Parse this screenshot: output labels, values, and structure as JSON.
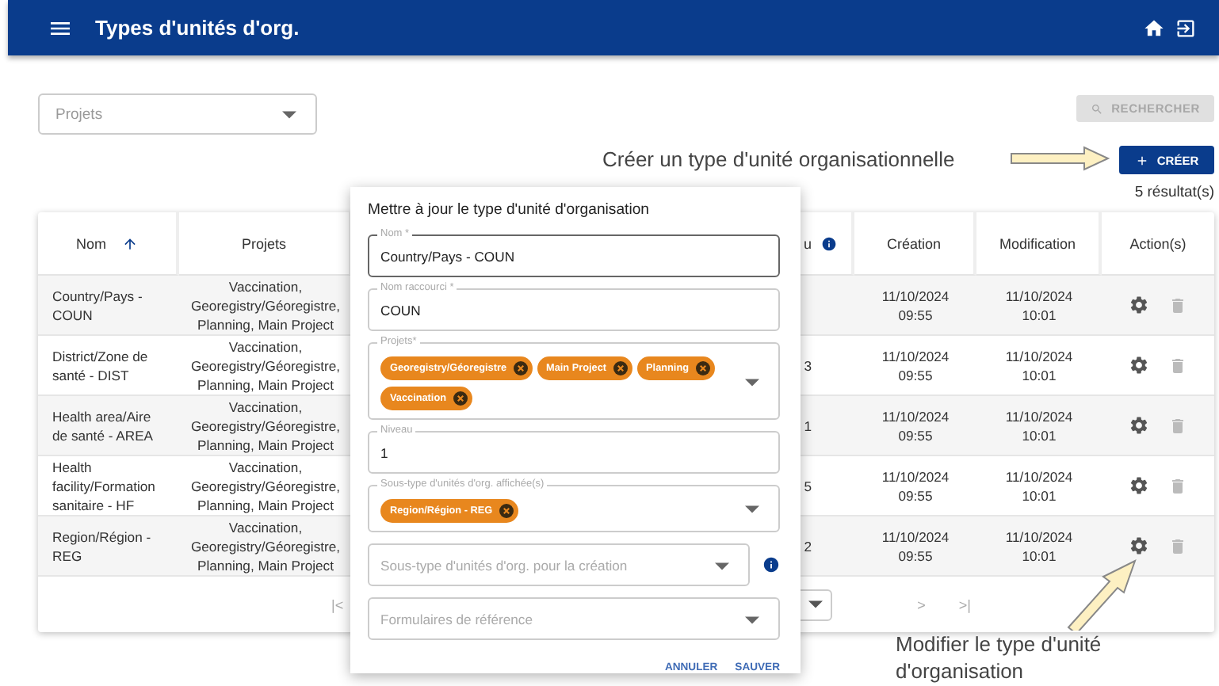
{
  "app_bar": {
    "title": "Types d'unités d'org."
  },
  "filters": {
    "projects_select": {
      "placeholder": "Projets"
    },
    "search_button": {
      "label": "RECHERCHER",
      "disabled": true
    }
  },
  "create_button": {
    "label": "CRÉER"
  },
  "result_count": "5 résultat(s)",
  "table": {
    "columns": [
      {
        "label": "Nom",
        "sorted": true,
        "info": false
      },
      {
        "label": "Projets",
        "sorted": false,
        "info": false
      },
      {
        "label": "u",
        "sorted": false,
        "info": true
      },
      {
        "label": "Création",
        "sorted": false,
        "info": false
      },
      {
        "label": "Modification",
        "sorted": false,
        "info": false
      },
      {
        "label": "Action(s)",
        "sorted": false,
        "info": false
      }
    ],
    "rows": [
      {
        "name": "Country/Pays - COUN",
        "projects": "Vaccination, Georegistry/Géoregistre, Planning, Main Project",
        "created": "11/10/2024 09:55",
        "modified": "11/10/2024 10:01"
      },
      {
        "name": "District/Zone de santé - DIST",
        "projects": "Vaccination, Georegistry/Géoregistre, Planning, Main Project",
        "column_3": "3",
        "created": "11/10/2024 09:55",
        "modified": "11/10/2024 10:01"
      },
      {
        "name": "Health area/Aire de santé - AREA",
        "projects": "Vaccination, Georegistry/Géoregistre, Planning, Main Project",
        "column_3": "1",
        "created": "11/10/2024 09:55",
        "modified": "11/10/2024 10:01"
      },
      {
        "name": "Health facility/Formation sanitaire - HF",
        "projects": "Vaccination, Georegistry/Géoregistre, Planning, Main Project",
        "column_3": "5",
        "created": "11/10/2024 09:55",
        "modified": "11/10/2024 10:01"
      },
      {
        "name": "Region/Région - REG",
        "projects": "Vaccination, Georegistry/Géoregistre, Planning, Main Project",
        "column_3": "2",
        "created": "11/10/2024 09:55",
        "modified": "11/10/2024 10:01"
      }
    ],
    "pagination": {
      "first": "|<",
      "next": ">",
      "last": ">|"
    }
  },
  "dialog": {
    "title": "Mettre à jour le type d'unité d'organisation",
    "fields": [
      {
        "kind": "text",
        "label": "Nom *",
        "value": "Country/Pays - COUN",
        "focused": true
      },
      {
        "kind": "text",
        "label": "Nom raccourci *",
        "value": "COUN",
        "focused": false
      },
      {
        "kind": "chips",
        "label": "Projets*",
        "chips": [
          "Georegistry/Géoregistre",
          "Main Project",
          "Planning",
          "Vaccination"
        ],
        "focused": false
      },
      {
        "kind": "text",
        "label": "Niveau",
        "value": "1",
        "focused": false
      },
      {
        "kind": "chips",
        "label": "Sous-type d'unités d'org. affichée(s)",
        "chips": [
          "Region/Région - REG"
        ],
        "focused": false
      },
      {
        "kind": "select",
        "placeholder": "Sous-type d'unités d'org. pour la création",
        "info": true,
        "focused": false
      },
      {
        "kind": "select",
        "placeholder": "Formulaires de référence",
        "info": false,
        "focused": false
      }
    ],
    "buttons": [
      "ANNULER",
      "SAUVER"
    ]
  },
  "callouts": [
    {
      "kind": "arrow_right",
      "text": "Créer un type d'unité organisationnelle"
    },
    {
      "kind": "arrow_up_right",
      "text": "Modifier le type d'unité d'organisation"
    }
  ]
}
